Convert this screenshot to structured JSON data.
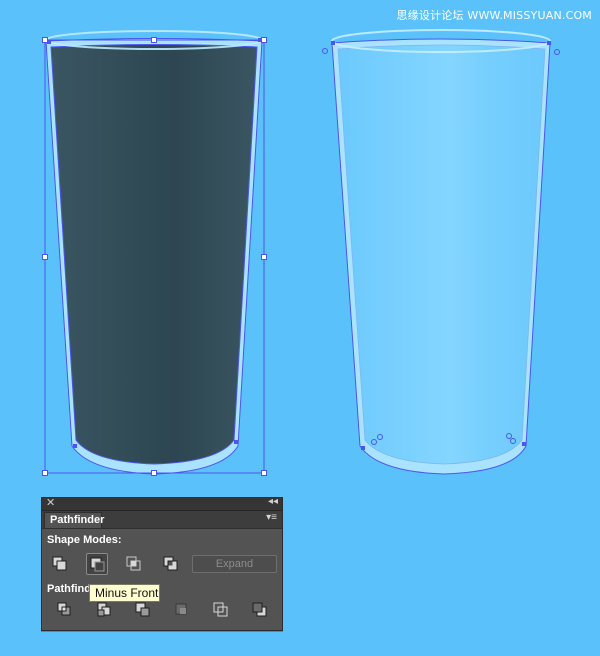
{
  "watermark": "思缘设计论坛 WWW.MISSYUAN.COM",
  "panel": {
    "title": "Pathfinder",
    "close_icon": "close-icon",
    "collapse_icon": "double-chevron-left-icon",
    "menu_icon": "panel-menu-icon",
    "shape_modes_label": "Shape Modes:",
    "pathfinders_label": "Pathfind",
    "expand_label": "Expand",
    "shape_modes": [
      {
        "name": "unite",
        "icon": "unite-icon",
        "active": false
      },
      {
        "name": "minus-front",
        "icon": "minus-front-icon",
        "active": true
      },
      {
        "name": "intersect",
        "icon": "intersect-icon",
        "active": false
      },
      {
        "name": "exclude",
        "icon": "exclude-icon",
        "active": false
      }
    ],
    "pathfinders": [
      {
        "name": "divide",
        "icon": "divide-icon"
      },
      {
        "name": "trim",
        "icon": "trim-icon"
      },
      {
        "name": "merge",
        "icon": "merge-icon"
      },
      {
        "name": "crop",
        "icon": "crop-icon"
      },
      {
        "name": "outline",
        "icon": "outline-icon"
      },
      {
        "name": "minus-back",
        "icon": "minus-back-icon"
      }
    ],
    "tooltip": "Minus Front"
  },
  "colors": {
    "background": "#5bc1fb",
    "dark_fill": "#35505c",
    "selection": "#4b56ef",
    "glass_fill": "#7ad0ff",
    "glass_rim": "#a9e3ff"
  }
}
